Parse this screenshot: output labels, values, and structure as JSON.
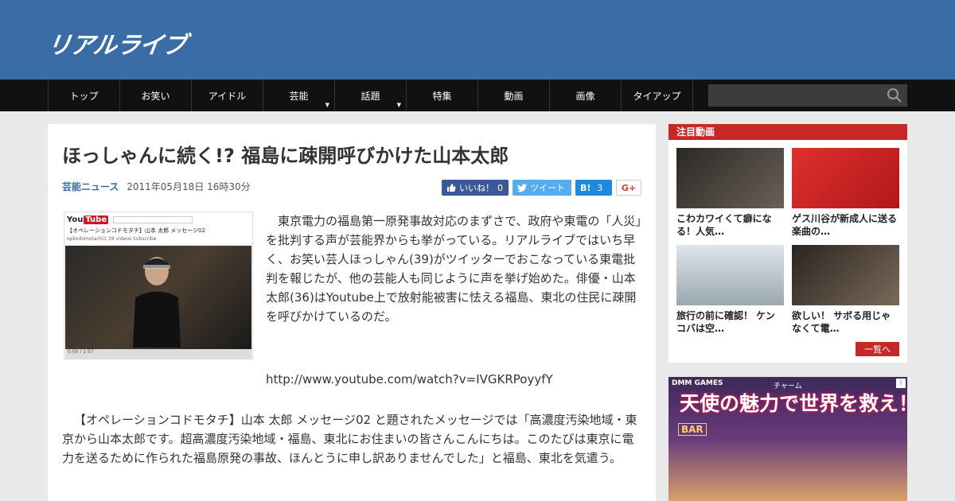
{
  "header": {
    "logo": "リアルライブ"
  },
  "nav": {
    "items": [
      {
        "label": "トップ",
        "dropdown": false
      },
      {
        "label": "お笑い",
        "dropdown": false
      },
      {
        "label": "アイドル",
        "dropdown": false
      },
      {
        "label": "芸能",
        "dropdown": true
      },
      {
        "label": "話題",
        "dropdown": true
      },
      {
        "label": "特集",
        "dropdown": false
      },
      {
        "label": "動画",
        "dropdown": false
      },
      {
        "label": "画像",
        "dropdown": false
      },
      {
        "label": "タイアップ",
        "dropdown": false
      }
    ],
    "caret": "▼"
  },
  "article": {
    "title": "ほっしゃんに続く!? 福島に疎開呼びかけた山本太郎",
    "category": "芸能ニュース",
    "date": "2011年05月18日 16時30分",
    "share": {
      "like_label": "いいね！",
      "like_count": "0",
      "tweet_label": "ツイート",
      "hatena_label": "B!",
      "hatena_count": "3",
      "gplus_label": "G+"
    },
    "thumbnail": {
      "yt_logo_a": "You",
      "yt_logo_b": "Tube",
      "video_title": "【オペレーションコドモタチ】山本 太郎 メッセージ02",
      "channel": "opkodomotachi1   39 videos   Subscribe",
      "time": "0:00 / 1:57"
    },
    "paragraph1": "東京電力の福島第一原発事故対応のまずさで、政府や東電の「人災」を批判する声が芸能界からも挙がっている。リアルライブではいち早く、お笑い芸人ほっしゃん(39)がツイッターでおこなっている東電批判を報じたが、他の芸能人も同じように声を挙げ始めた。俳優・山本太郎(36)はYoutube上で放射能被害に怯える福島、東北の住民に疎開を呼びかけているのだ。",
    "url": "http://www.youtube.com/watch?v=IVGKRPoyyfY",
    "paragraph2": "【オペレーションコドモタチ】山本 太郎 メッセージ02 と題されたメッセージでは「高濃度汚染地域・東京から山本太郎です。超高濃度汚染地域・福島、東北にお住まいの皆さんこんにちは。このたびは東京に電力を送るために作られた福島原発の事故、ほんとうに申し訳ありませんでした」と福島、東北を気遣う。"
  },
  "sidebar": {
    "heading": "注目動画",
    "videos": [
      {
        "caption": "こわカワイくて癖になる！人気…",
        "color": "#3d3a35"
      },
      {
        "caption": "ゲス川谷が新成人に送る楽曲の…",
        "color": "#d92a2a"
      },
      {
        "caption": "旅行の前に確認！ ケンコバは空…",
        "color": "#b8c4cc"
      },
      {
        "caption": "欲しい！ サボる用じゃなくて電…",
        "color": "#4a4038"
      }
    ],
    "more_label": "一覧へ"
  },
  "ad": {
    "brand": "DMM GAMES",
    "ruby": "チャーム",
    "headline": "天使の魅力で世界を救え！",
    "sign": "BAR",
    "info": "i"
  }
}
